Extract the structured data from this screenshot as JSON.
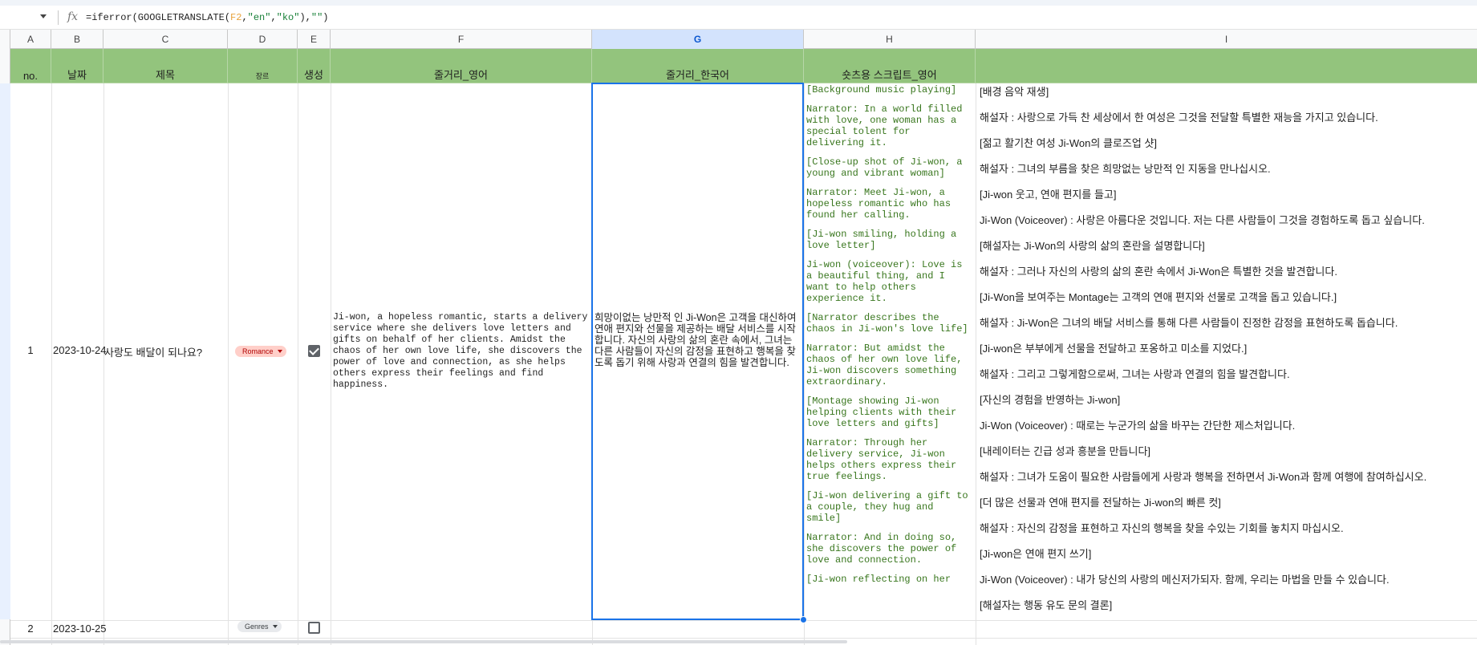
{
  "formula": {
    "prefix": "=iferror(GOOGLETRANSLATE(",
    "ref": "F2",
    "comma1": ",",
    "arg1": "\"en\"",
    "comma2": ",",
    "arg2": "\"ko\"",
    "mid": "),",
    "arg3": "\"\"",
    "suffix": ")"
  },
  "columns": [
    "A",
    "B",
    "C",
    "D",
    "E",
    "F",
    "G",
    "H",
    "I"
  ],
  "selected_column": "G",
  "header_row": {
    "no": "no.",
    "date": "날짜",
    "title": "제목",
    "genre": "장르",
    "generate": "생성",
    "plot_en": "줄거리_영어",
    "plot_ko": "줄거리_한국어",
    "shorts_en": "숏츠용 스크립트_영어",
    "col_i": ""
  },
  "rows": [
    {
      "no": "1",
      "date": "2023-10-24",
      "title": "사랑도 배달이 되나요?",
      "genre": "Romance",
      "generate": true,
      "plot_en": "Ji-won, a hopeless romantic, starts a delivery service where she delivers love letters and gifts on behalf of her clients. Amidst the chaos of her own love life, she discovers the power of love and connection, as she helps others express their feelings and find happiness.",
      "plot_ko": "희망이없는 낭만적 인 Ji-Won은 고객을 대신하여 연애 편지와 선물을 제공하는 배달 서비스를 시작합니다. 자신의 사랑의 삶의 혼란 속에서, 그녀는 다른 사람들이 자신의 감정을 표현하고 행복을 찾도록 돕기 위해 사랑과 연결의 힘을 발견합니다.",
      "shorts_en": [
        "[Background music playing]",
        "Narrator: In a world filled with love, one woman has a special tolent for delivering it.",
        "[Close-up shot of Ji-won, a young and vibrant woman]",
        "Narrator: Meet Ji-won, a hopeless romantic who has found her calling.",
        "[Ji-won smiling, holding a love letter]",
        "Ji-won (voiceover): Love is a beautiful thing, and I want to help others experience it.",
        "[Narrator describes the chaos in Ji-won's love life]",
        "Narrator: But amidst the chaos of her own love life, Ji-won discovers something extraordinary.",
        "[Montage showing Ji-won helping clients with their love letters and gifts]",
        "Narrator: Through her delivery service, Ji-won helps others express their true feelings.",
        "[Ji-won delivering a gift to a couple, they hug and smile]",
        "Narrator: And in doing so, she discovers the power of love and connection.",
        "[Ji-won reflecting on her"
      ],
      "col_i": [
        "[배경 음악 재생]",
        "해설자 : 사랑으로 가득 찬 세상에서 한 여성은 그것을 전달할 특별한 재능을 가지고 있습니다.",
        "[젊고 활기찬 여성 Ji-Won의 클로즈업 샷]",
        "해설자 : 그녀의 부름을 찾은 희망없는 낭만적 인 지동을 만나십시오.",
        "[Ji-won 웃고, 연애 편지를 들고]",
        "Ji-Won (Voiceover) : 사랑은 아름다운 것입니다. 저는 다른 사람들이 그것을 경험하도록 돕고 싶습니다.",
        "[해설자는 Ji-Won의 사랑의 삶의 혼란을 설명합니다]",
        "해설자 : 그러나 자신의 사랑의 삶의 혼란 속에서 Ji-Won은 특별한 것을 발견합니다.",
        "[Ji-Won을 보여주는 Montage는 고객의 연애 편지와 선물로 고객을 돕고 있습니다.]",
        "해설자 : Ji-Won은 그녀의 배달 서비스를 통해 다른 사람들이 진정한 감정을 표현하도록 돕습니다.",
        "[Ji-won은 부부에게 선물을 전달하고 포옹하고 미소를 지었다.]",
        "해설자 : 그리고 그렇게함으로써, 그녀는 사랑과 연결의 힘을 발견합니다.",
        "[자신의 경험을 반영하는 Ji-won]",
        "Ji-Won (Voiceover) : 때로는 누군가의 삶을 바꾸는 간단한 제스처입니다.",
        "[내레이터는 긴급 성과 흥분을 만듭니다]",
        "해설자 : 그녀가 도움이 필요한 사람들에게 사랑과 행복을 전하면서 Ji-Won과 함께 여행에 참여하십시오.",
        "[더 많은 선물과 연애 편지를 전달하는 Ji-won의 빠른 컷]",
        "해설자 : 자신의 감정을 표현하고 자신의 행복을 찾을 수있는 기회를 놓치지 마십시오.",
        "[Ji-won은 연애 편지 쓰기]",
        "Ji-Won (Voiceover) : 내가 당신의 사랑의 메신저가되자. 함께, 우리는 마법을 만들 수 있습니다.",
        "[해설자는 행동 유도 문의 결론]"
      ]
    },
    {
      "no": "2",
      "date": "2023-10-25",
      "genre": "Genres",
      "generate": false
    }
  ],
  "colors": {
    "header_green": "#93c47d",
    "script_green": "#38761d",
    "selection_blue": "#1a73e8",
    "romance_chip": "#ffcfc9"
  }
}
